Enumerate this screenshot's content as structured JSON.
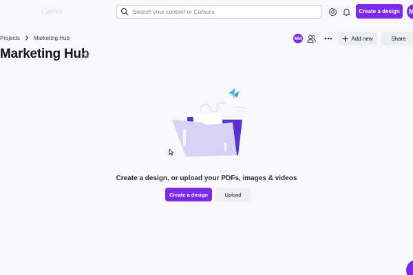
{
  "topbar": {
    "search_placeholder": "Search your content or Canva's",
    "create_label": "Create a design",
    "avatar_initial": "M"
  },
  "breadcrumb": {
    "items": [
      "Projects",
      "Marketing Hub"
    ]
  },
  "header": {
    "collaborator_initials": "MM",
    "add_new_label": "Add new",
    "share_label": "Share"
  },
  "page": {
    "title": "Marketing Hub"
  },
  "empty_state": {
    "message": "Create a design, or upload your PDFs, images & videos",
    "create_label": "Create a design",
    "upload_label": "Upload"
  },
  "icons": {
    "search": "search-icon",
    "settings": "gear-icon",
    "notifications": "bell-icon",
    "breadcrumb_separator": "chevron-right-icon",
    "people": "people-icon",
    "more": "more-horizontal-icon",
    "add": "plus-icon",
    "star": "star-outline-icon",
    "cursor": "mouse-cursor-icon"
  },
  "colors": {
    "accent": "#7d2ae8",
    "background": "#f8f8fa",
    "secondary_button": "#eceef2",
    "folder_front": "#d8d3f5",
    "folder_back": "#5a2fd6"
  }
}
